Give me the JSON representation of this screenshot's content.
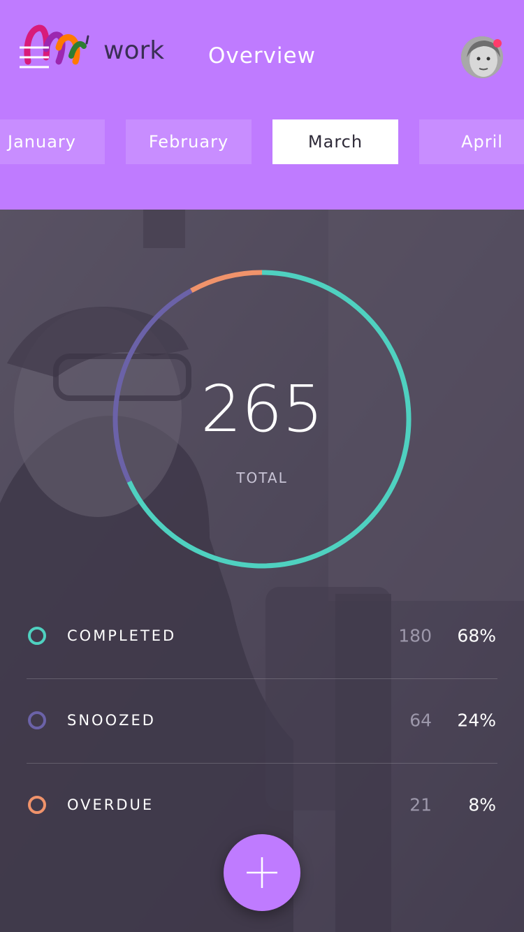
{
  "header": {
    "logo_word": "work",
    "title": "Overview",
    "avatar_notification": true
  },
  "months": [
    {
      "label": "January",
      "active": false
    },
    {
      "label": "February",
      "active": false
    },
    {
      "label": "March",
      "active": true
    },
    {
      "label": "April",
      "active": false
    }
  ],
  "summary": {
    "total": "265",
    "total_label": "TOTAL"
  },
  "stats": [
    {
      "label": "COMPLETED",
      "count": "180",
      "percent": "68%",
      "fraction": 0.68,
      "color": "#4fd1c0"
    },
    {
      "label": "SNOOZED",
      "count": "64",
      "percent": "24%",
      "fraction": 0.24,
      "color": "#6b62a8"
    },
    {
      "label": "OVERDUE",
      "count": "21",
      "percent": "8%",
      "fraction": 0.08,
      "color": "#f0936b"
    }
  ],
  "colors": {
    "accent": "#bf7bff",
    "overlay": "#4a4458",
    "notification": "#ff3b6b"
  },
  "icons": {
    "menu": "hamburger-icon",
    "add": "plus-icon"
  }
}
